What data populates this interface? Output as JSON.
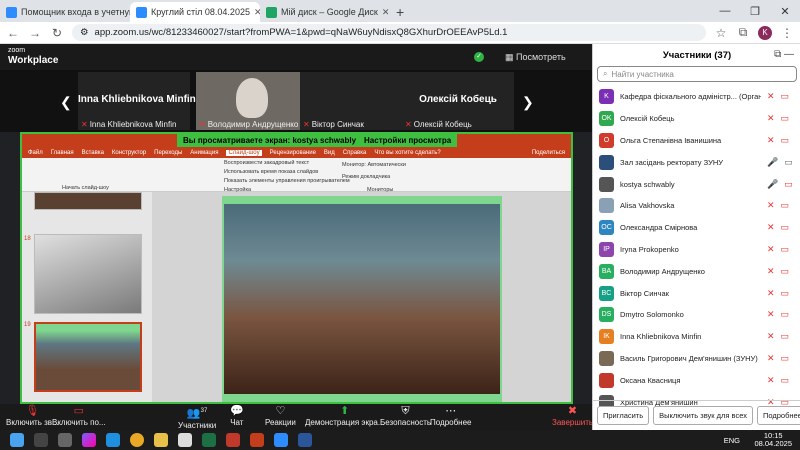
{
  "browser": {
    "tabs": [
      {
        "title": "Помощник входа в учетную з",
        "color": "#2d8cff"
      },
      {
        "title": "Круглий стіл 08.04.2025",
        "color": "#2d8cff"
      },
      {
        "title": "Мій диск – Google Диск",
        "color": "#1fa463"
      }
    ],
    "url": "app.zoom.us/wc/81233460027/start?fromPWA=1&pwd=qNaW6uyNdisxQ8GXhurDrOEEAvP5Ld.1"
  },
  "zoom": {
    "logo_top": "zoom",
    "logo_bottom": "Workplace",
    "view_label": "Посмотреть",
    "tiles": [
      {
        "big": "Inna Khliebnikova Minfin",
        "label": "Inna Khliebnikova Minfin"
      },
      {
        "big": "",
        "label": "Володимир Андрущенко"
      },
      {
        "big": "",
        "label": "Віктор Синчак"
      },
      {
        "big": "Олексій Кобець",
        "label": "Олексій Кобець"
      }
    ],
    "share_banner": "Вы просматриваете экран: kostya schwably",
    "view_settings": "Настройки просмотра",
    "toolbar": {
      "mic": "Включить зв...",
      "video": "Включить по...",
      "participants": "Участники",
      "participants_count": "37",
      "chat": "Чат",
      "reactions": "Реакции",
      "share": "Демонстрация экра...",
      "security": "Безопасность",
      "more": "Подробнее",
      "end": "Завершить"
    }
  },
  "ppt": {
    "menu": [
      "Файл",
      "Главная",
      "Вставка",
      "Конструктор",
      "Переходы",
      "Анимация",
      "Слайд-шоу",
      "Рецензирование",
      "Вид",
      "Справка",
      "Что вы хотите сделать?"
    ],
    "share_link": "Поделиться",
    "ribbon_options": [
      "Воспроизвести закадровый текст",
      "Использовать время показа слайдов",
      "Показать элементы управления проигрывателем",
      "Монитор: Автоматически",
      "Режим докладчика"
    ],
    "ribbon_groups": [
      "Начать слайд-шоу",
      "Настройка",
      "Мониторы"
    ],
    "slide_numbers": [
      "18",
      "19"
    ]
  },
  "participants": {
    "title": "Участники (37)",
    "search_placeholder": "Найти участника",
    "list": [
      {
        "initials": "K",
        "color": "#7b2fb5",
        "name": "Кафедра фіскального адміністр... (Організатор, Я)",
        "mic": "off",
        "video": "off"
      },
      {
        "initials": "OK",
        "color": "#2fa84f",
        "name": "Олексій Кобець",
        "mic": "off",
        "video": "off"
      },
      {
        "initials": "O",
        "color": "#d13b2b",
        "name": "Ольга Степанівна Іванишина",
        "mic": "off",
        "video": "off"
      },
      {
        "initials": "",
        "color": "#2b4e7a",
        "name": "Зал засідань ректорату ЗУНУ",
        "mic": "on",
        "video": "on"
      },
      {
        "initials": "",
        "color": "#555555",
        "name": "kostya schwably",
        "mic": "on",
        "video": "off"
      },
      {
        "initials": "",
        "color": "#8aa0b5",
        "name": "Alisa Vakhovska",
        "mic": "off",
        "video": "off"
      },
      {
        "initials": "OC",
        "color": "#2e86c1",
        "name": "Олександра Смірнова",
        "mic": "off",
        "video": "off"
      },
      {
        "initials": "IP",
        "color": "#8e44ad",
        "name": "Iryna Prokopenko",
        "mic": "off",
        "video": "off"
      },
      {
        "initials": "BA",
        "color": "#27ae60",
        "name": "Володимир Андрущенко",
        "mic": "off",
        "video": "off"
      },
      {
        "initials": "BC",
        "color": "#16a085",
        "name": "Віктор Синчак",
        "mic": "off",
        "video": "off"
      },
      {
        "initials": "DS",
        "color": "#27ae60",
        "name": "Dmytro Solomonko",
        "mic": "off",
        "video": "off"
      },
      {
        "initials": "IK",
        "color": "#e67e22",
        "name": "Inna Khliebnikova Minfin",
        "mic": "off",
        "video": "off"
      },
      {
        "initials": "",
        "color": "#7a6a55",
        "name": "Василь Григорович Дем'янишин (ЗУНУ)",
        "mic": "off",
        "video": "off"
      },
      {
        "initials": "",
        "color": "#c0392b",
        "name": "Оксана Квасниця",
        "mic": "off",
        "video": "off"
      },
      {
        "initials": "",
        "color": "#555555",
        "name": "Христина Дем'янишин",
        "mic": "off",
        "video": "off"
      }
    ],
    "invite": "Пригласить",
    "mute_all": "Выключить звук для всех",
    "more": "Подробнее"
  },
  "taskbar": {
    "lang": "ENG",
    "time": "10:15",
    "date": "08.04.2025"
  }
}
